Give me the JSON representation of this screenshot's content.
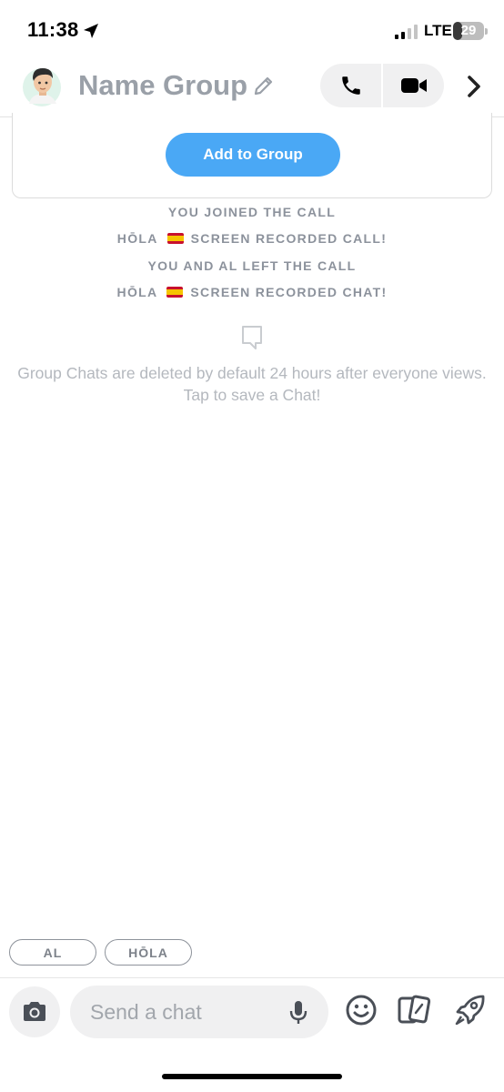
{
  "status_bar": {
    "time": "11:38",
    "network": "LTE",
    "battery": "29",
    "battery_level": 0.29
  },
  "header": {
    "group_name": "Name Group",
    "icons": [
      "avatar",
      "pencil-icon",
      "phone-icon",
      "video-icon",
      "chevron-right-icon"
    ]
  },
  "card": {
    "add_button_label": "Add to Group"
  },
  "system_messages": {
    "m1": "YOU JOINED THE CALL",
    "m2_name": "HŌLA",
    "m2_text": "SCREEN RECORDED CALL!",
    "m3": "YOU AND AL LEFT THE CALL",
    "m4_name": "HŌLA",
    "m4_text": "SCREEN RECORDED CHAT!"
  },
  "info": {
    "line1": "Group Chats are deleted by default 24 hours after everyone views.",
    "line2": "Tap to save a Chat!"
  },
  "members": {
    "chip1": "AL",
    "chip2": "HŌLA"
  },
  "composer": {
    "placeholder": "Send a chat",
    "icons": [
      "camera-icon",
      "mic-icon",
      "emoji-icon",
      "cards-icon",
      "rocket-icon"
    ]
  },
  "colors": {
    "accent_blue": "#4aa8f5",
    "muted_text": "#8c929c",
    "name_gray": "#9aa0a8",
    "pill_bg": "#f0f0f1"
  }
}
